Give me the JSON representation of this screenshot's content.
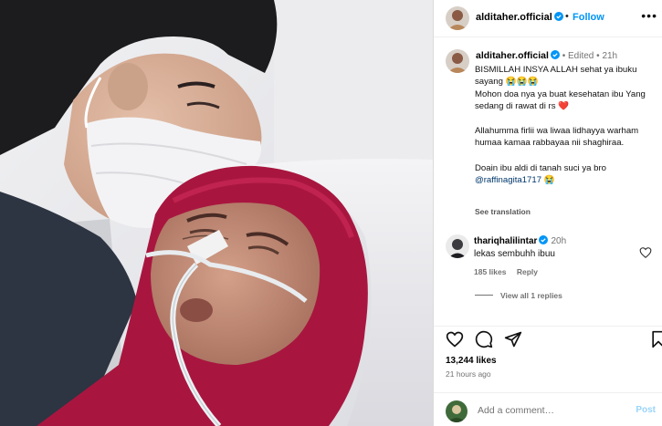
{
  "post": {
    "image_alt_subject": "hospital-photo",
    "header": {
      "username": "alditaher.official",
      "separator": "•",
      "follow_label": "Follow",
      "more_icon": "more-horizontal-icon"
    },
    "caption": {
      "username": "alditaher.official",
      "edited": "Edited",
      "time": "21h",
      "line1": "BISMILLAH INSYA ALLAH sehat ya ibuku sayang 😭😭😭",
      "line2": "Mohon doa nya ya buat kesehatan ibu Yang sedang di rawat di rs ❤️",
      "line3": "Allahumma firlii wa liwaa lidhayya warham humaa kamaa rabbayaa nii shaghiraa.",
      "line4": "Doain ibu aldi di tanah suci ya bro",
      "mention": "@raffinagita1717",
      "mention_emoji": "😭",
      "see_translation": "See translation"
    },
    "comment": {
      "username": "thariqhalilintar",
      "time": "20h",
      "text": "lekas sembuhh ibuu",
      "likes": "185 likes",
      "reply_label": "Reply",
      "view_replies": "View all 1 replies"
    },
    "likes_count": "13,244 likes",
    "posted_ago": "21 hours ago",
    "add_comment": {
      "placeholder": "Add a comment…",
      "post_label": "Post"
    }
  },
  "colors": {
    "link": "#0095f6",
    "muted": "#737373",
    "hijab": "#a8163f",
    "border": "#dbdbdb"
  }
}
